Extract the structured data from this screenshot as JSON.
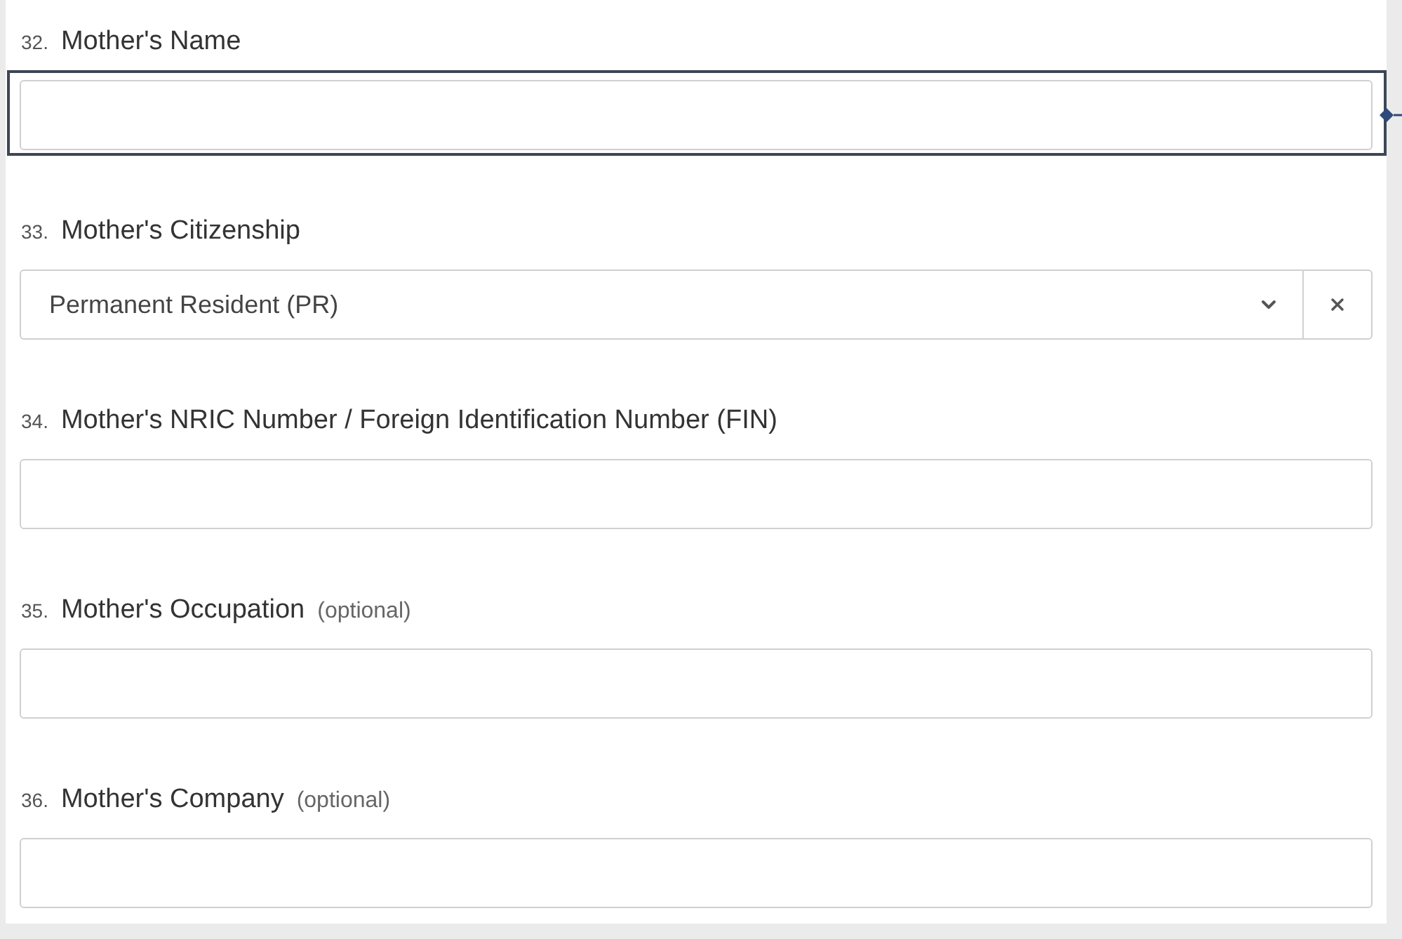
{
  "fields": [
    {
      "number": "32.",
      "label": "Mother's Name",
      "kind": "text",
      "focused": true
    },
    {
      "number": "33.",
      "label": "Mother's Citizenship",
      "kind": "select",
      "value": "Permanent Resident (PR)",
      "focused": false
    },
    {
      "number": "34.",
      "label": "Mother's NRIC Number / Foreign Identification Number (FIN)",
      "kind": "text",
      "focused": false
    },
    {
      "number": "35.",
      "label": "Mother's Occupation",
      "note": "(optional)",
      "kind": "text",
      "focused": false
    },
    {
      "number": "36.",
      "label": "Mother's Company",
      "note": "(optional)",
      "kind": "text",
      "focused": false
    }
  ]
}
